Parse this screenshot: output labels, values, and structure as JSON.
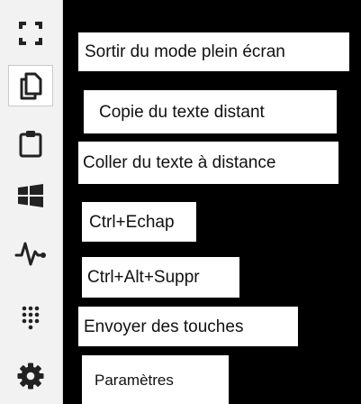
{
  "menu": {
    "items": [
      {
        "key": "fullscreen",
        "label": "Sortir du mode plein écran",
        "icon": "exit-fullscreen-icon"
      },
      {
        "key": "copy",
        "label": "Copie du texte distant",
        "icon": "copy-icon"
      },
      {
        "key": "paste",
        "label": "Coller du texte à distance",
        "icon": "clipboard-icon"
      },
      {
        "key": "ctrl_esc",
        "label": "Ctrl+Echap",
        "icon": "windows-icon"
      },
      {
        "key": "ctrl_alt_del",
        "label": "Ctrl+Alt+Suppr",
        "icon": "pulse-icon"
      },
      {
        "key": "send_keys",
        "label": "Envoyer des touches",
        "icon": "keypad-icon"
      },
      {
        "key": "settings",
        "label": "Paramètres",
        "icon": "gear-icon"
      }
    ]
  },
  "colors": {
    "background": "#000000",
    "sidebar": "#f2f2f2",
    "icon": "#222222",
    "label_bg": "#ffffff"
  }
}
